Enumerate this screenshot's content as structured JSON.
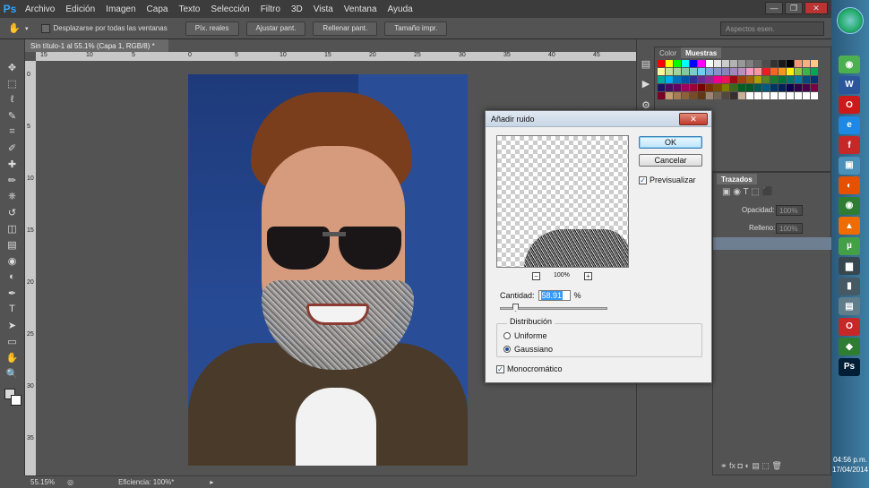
{
  "app": {
    "logo": "Ps"
  },
  "menu": [
    "Archivo",
    "Edición",
    "Imagen",
    "Capa",
    "Texto",
    "Selección",
    "Filtro",
    "3D",
    "Vista",
    "Ventana",
    "Ayuda"
  ],
  "window_controls": {
    "minimize": "—",
    "restore": "❐",
    "close": "✕"
  },
  "options_bar": {
    "scroll_all_label": "Desplazarse por todas las ventanas",
    "buttons": [
      "Píx. reales",
      "Ajustar pant.",
      "Rellenar pant.",
      "Tamaño impr."
    ],
    "workspace": "Aspectos esen."
  },
  "document": {
    "tab_title": "Sin título-1 al 55.1% (Capa 1, RGB/8) *",
    "ruler_top": [
      "15",
      "10",
      "5",
      "0",
      "5",
      "10",
      "15",
      "20",
      "25",
      "30",
      "35",
      "40",
      "45"
    ],
    "ruler_left": [
      "0",
      "5",
      "10",
      "15",
      "20",
      "25",
      "30",
      "35"
    ]
  },
  "tools": [
    "move-tool",
    "marquee-tool",
    "lasso-tool",
    "quick-select-tool",
    "crop-tool",
    "eyedropper-tool",
    "healing-tool",
    "brush-tool",
    "stamp-tool",
    "history-brush-tool",
    "eraser-tool",
    "gradient-tool",
    "blur-tool",
    "dodge-tool",
    "pen-tool",
    "type-tool",
    "path-select-tool",
    "shape-tool",
    "hand-tool",
    "zoom-tool"
  ],
  "tool_glyphs": [
    "✥",
    "⬚",
    "ℓ",
    "✎",
    "⌗",
    "✐",
    "✚",
    "✏",
    "⎈",
    "↺",
    "◫",
    "▤",
    "◉",
    "◐",
    "✒",
    "T",
    "➤",
    "▭",
    "✋",
    "🔍"
  ],
  "swatches_panel": {
    "tabs": [
      "Color",
      "Muestras"
    ],
    "colors": [
      "#ff0000",
      "#ffff00",
      "#00ff00",
      "#00ffff",
      "#0000ff",
      "#ff00ff",
      "#ffffff",
      "#e6e6e6",
      "#cccccc",
      "#b3b3b3",
      "#999999",
      "#808080",
      "#666666",
      "#4d4d4d",
      "#333333",
      "#1a1a1a",
      "#000000",
      "#f7977a",
      "#f9ad81",
      "#fdc68a",
      "#fff79a",
      "#c4df9b",
      "#a3d39c",
      "#82ca9d",
      "#7bcdc8",
      "#6ecff6",
      "#7ea7d8",
      "#8493ca",
      "#8882be",
      "#a187be",
      "#bc8dbf",
      "#f49ac2",
      "#f6989d",
      "#ed1c24",
      "#f26522",
      "#f7941d",
      "#fff200",
      "#8dc73f",
      "#39b54a",
      "#00a651",
      "#00a99d",
      "#00aeef",
      "#0072bc",
      "#0054a6",
      "#2e3192",
      "#662d91",
      "#92278f",
      "#ec008c",
      "#ed145b",
      "#9e0b0f",
      "#a0410d",
      "#a36209",
      "#aba000",
      "#598527",
      "#1a7b30",
      "#007236",
      "#00746b",
      "#0076a3",
      "#004b80",
      "#003471",
      "#1b1464",
      "#440e62",
      "#630460",
      "#9e005d",
      "#9e0039",
      "#790000",
      "#7b2e00",
      "#7d4900",
      "#827b00",
      "#406618",
      "#005e20",
      "#005826",
      "#005952",
      "#005b7f",
      "#003663",
      "#002157",
      "#0d004c",
      "#32004b",
      "#4b0049",
      "#7b0046",
      "#7a0026",
      "#c69c6d",
      "#a67c52",
      "#8c6239",
      "#754c24",
      "#603913",
      "#998675",
      "#736357",
      "#534741",
      "#362f2d",
      "#c7b299",
      "#ffffff",
      "#ffffff",
      "#ffffff",
      "#ffffff",
      "#ffffff",
      "#ffffff",
      "#ffffff",
      "#ffffff",
      "#ffffff"
    ]
  },
  "layers_panel": {
    "tab": "Trazados",
    "opacity_label": "Opacidad:",
    "opacity_value": "100%",
    "fill_label": "Relleno:",
    "fill_value": "100%"
  },
  "status_bar": {
    "zoom": "55.15%",
    "efficiency": "Eficiencia: 100%*"
  },
  "taskbar": {
    "time": "04:56 p.m.",
    "date": "17/04/2014",
    "icons": [
      {
        "name": "chrome-icon",
        "glyph": "◉",
        "color": "#4caf50"
      },
      {
        "name": "word-icon",
        "glyph": "W",
        "color": "#2b579a"
      },
      {
        "name": "opera-icon",
        "glyph": "O",
        "color": "#cc1a1a"
      },
      {
        "name": "ie-icon",
        "glyph": "e",
        "color": "#1e88e5"
      },
      {
        "name": "flash-icon",
        "glyph": "f",
        "color": "#c62828"
      },
      {
        "name": "app-icon",
        "glyph": "▣",
        "color": "#4a90b8"
      },
      {
        "name": "firefox-icon",
        "glyph": "◐",
        "color": "#e65100"
      },
      {
        "name": "chrome-alt-icon",
        "glyph": "◉",
        "color": "#2e7d32"
      },
      {
        "name": "vlc-icon",
        "glyph": "▲",
        "color": "#ef6c00"
      },
      {
        "name": "utorrent-icon",
        "glyph": "µ",
        "color": "#43a047"
      },
      {
        "name": "monitor-icon",
        "glyph": "▆",
        "color": "#37474f"
      },
      {
        "name": "phone-icon",
        "glyph": "▮",
        "color": "#455a64"
      },
      {
        "name": "folder-icon",
        "glyph": "▤",
        "color": "#607d8b"
      },
      {
        "name": "opera-alt-icon",
        "glyph": "O",
        "color": "#c62828"
      },
      {
        "name": "green-app-icon",
        "glyph": "◆",
        "color": "#2e7d32"
      },
      {
        "name": "photoshop-task-icon",
        "glyph": "Ps",
        "color": "#001e36"
      }
    ]
  },
  "dialog": {
    "title": "Añadir ruido",
    "close": "✕",
    "ok": "OK",
    "cancel": "Cancelar",
    "preview_label": "Previsualizar",
    "preview_checked": true,
    "zoom": "100%",
    "zoom_minus": "−",
    "zoom_plus": "+",
    "amount_label": "Cantidad:",
    "amount_value": "58.91",
    "amount_unit": "%",
    "distribution_label": "Distribución",
    "uniform": "Uniforme",
    "gaussian": "Gaussiano",
    "monochrome": "Monocromático",
    "monochrome_checked": true,
    "check_mark": "✓"
  }
}
